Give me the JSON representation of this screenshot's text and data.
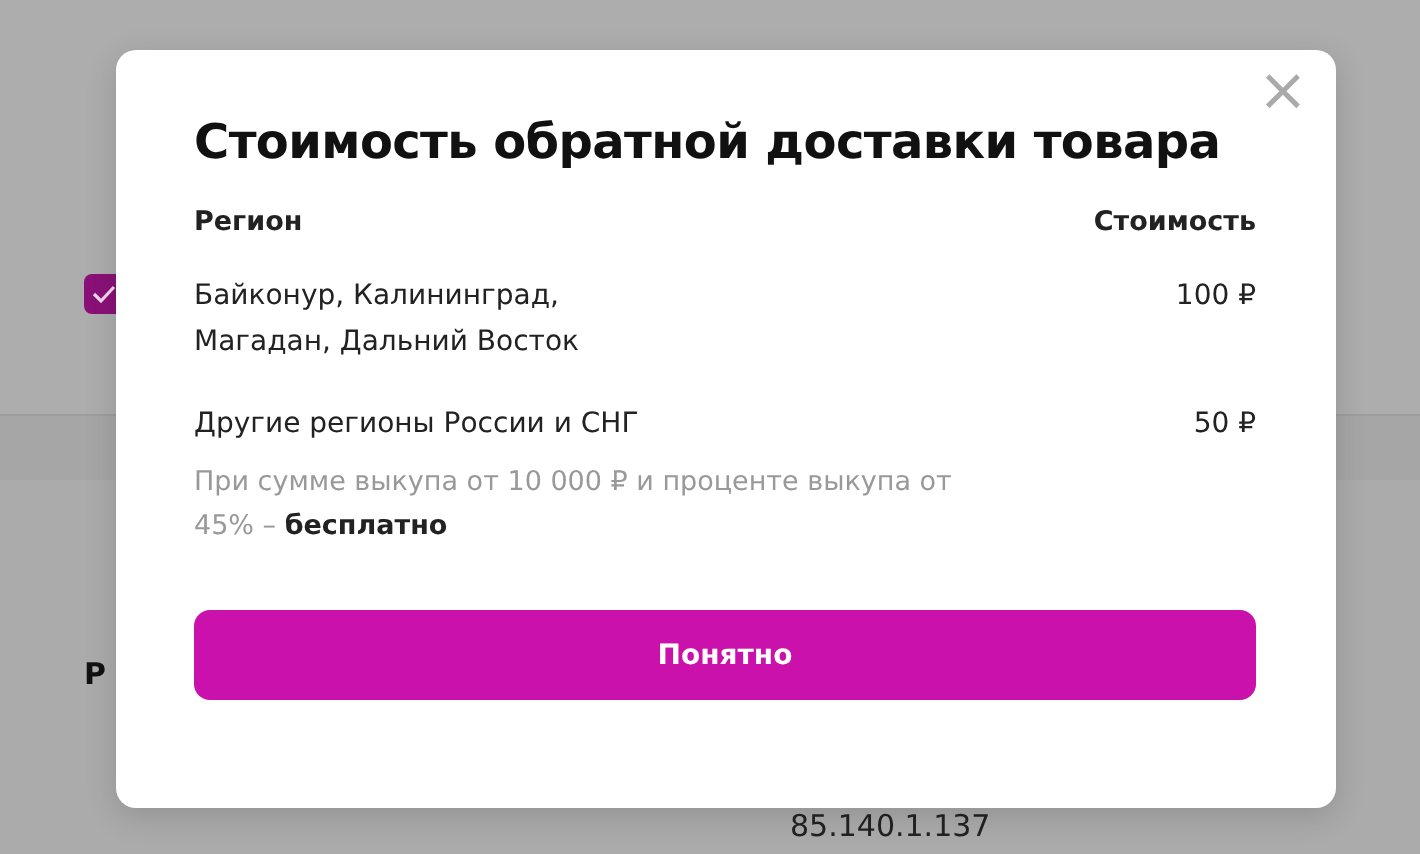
{
  "background": {
    "checkbox": {
      "checked": true
    },
    "label_fragment": "Р",
    "ip_address": "85.140.1.137"
  },
  "dialog": {
    "title": "Стоимость обратной доставки товара",
    "close": "×",
    "columns": [
      "Регион",
      "Стоимость"
    ],
    "rows": [
      {
        "region": "Байконур, Калининград,\nМагадан, Дальний Восток",
        "cost": "100 ₽"
      },
      {
        "region": "Другие регионы России и СНГ",
        "cost": "50 ₽",
        "note": "При сумме выкупа от 10 000 ₽ и проценте выкупа от 45% – **бесплатно**"
      }
    ],
    "button": "Понятно"
  }
}
